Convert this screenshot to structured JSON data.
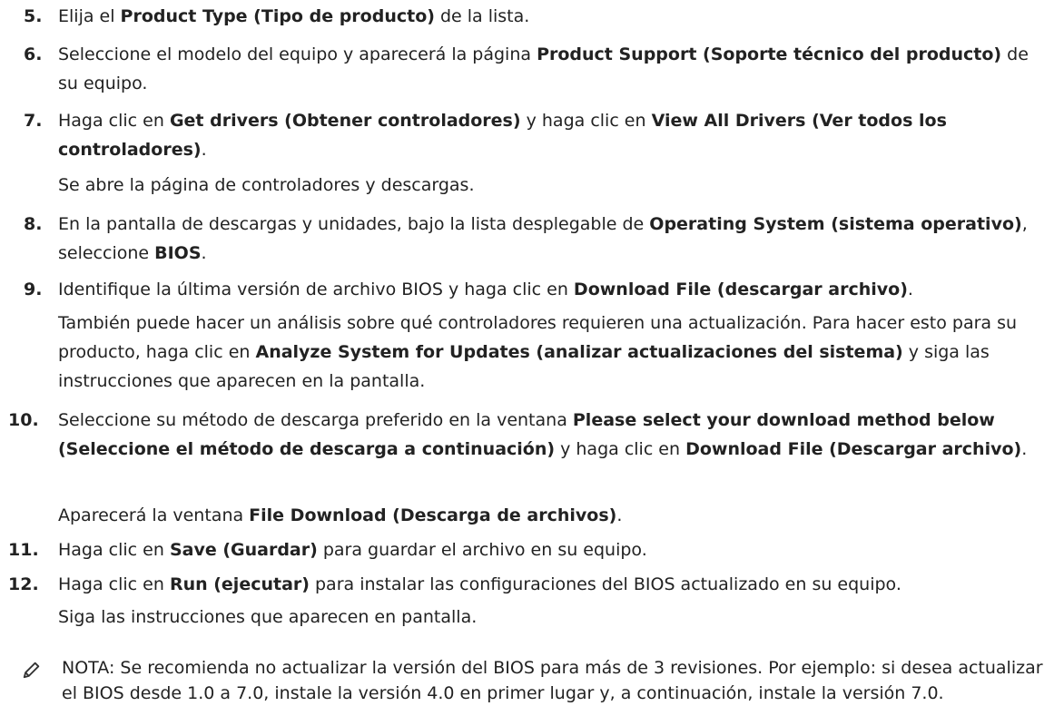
{
  "steps": [
    {
      "num": "5.",
      "parts": [
        "Elija el ",
        "Product Type (Tipo de producto)",
        " de la lista."
      ]
    },
    {
      "num": "6.",
      "parts": [
        "Seleccione el modelo del equipo y aparecerá la página ",
        "Product Support (Soporte técnico del producto)",
        " de su equipo."
      ]
    },
    {
      "num": "7.",
      "parts": [
        "Haga clic en ",
        "Get drivers (Obtener controladores)",
        " y haga clic en ",
        "View All Drivers (Ver todos los controladores)",
        "."
      ]
    },
    {
      "num": "8.",
      "parts": [
        "En la pantalla de descargas y unidades, bajo la lista desplegable de ",
        "Operating System (sistema operativo)",
        ", seleccione ",
        "BIOS",
        "."
      ]
    },
    {
      "num": "9.",
      "parts": [
        "Identifique la última versión de archivo BIOS y haga clic en ",
        "Download File (descargar archivo)",
        "."
      ]
    },
    {
      "num": "10.",
      "parts": [
        "Seleccione su método de descarga preferido en la ventana ",
        "Please select your download method below (Seleccione el método de descarga a continuación)",
        " y haga clic en ",
        "Download File (Descargar archivo)",
        "."
      ]
    },
    {
      "num": "11.",
      "parts": [
        "Haga clic en ",
        "Save (Guardar)",
        " para guardar el archivo en su equipo."
      ]
    },
    {
      "num": "12.",
      "parts": [
        "Haga clic en ",
        "Run (ejecutar)",
        " para instalar las configuraciones del BIOS actualizado en su equipo."
      ]
    }
  ],
  "paras": {
    "p7": "Se abre la página de controladores y descargas.",
    "p9": [
      "También puede hacer un análisis sobre qué controladores requieren una actualización. Para hacer esto para su producto, haga clic en ",
      "Analyze System for Updates (analizar actualizaciones del sistema)",
      " y siga las instrucciones que aparecen en la pantalla."
    ],
    "p10": [
      "Aparecerá la ventana ",
      "File Download (Descarga de archivos)",
      "."
    ],
    "p12": "Siga las instrucciones que aparecen en pantalla."
  },
  "note": {
    "label": "NOTA:",
    "text": " Se recomienda no actualizar la versión del BIOS para más de 3 revisiones. Por ejemplo: si desea actualizar el BIOS desde 1.0 a 7.0, instale la versión 4.0 en primer lugar y, a continuación, instale la versión 7.0.",
    "icon": "pencil-note-icon"
  }
}
